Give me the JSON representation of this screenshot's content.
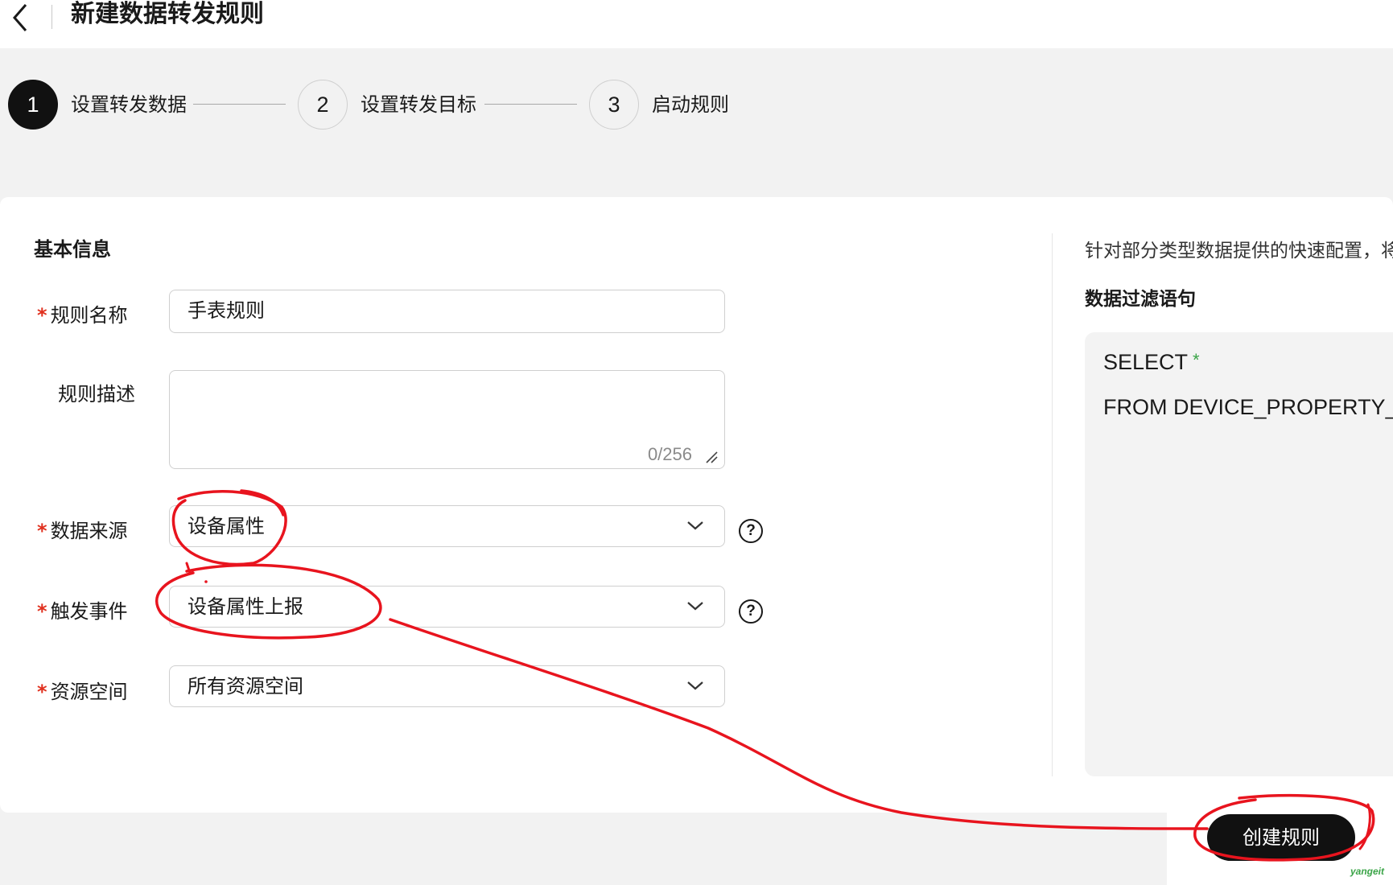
{
  "header": {
    "title": "新建数据转发规则"
  },
  "steps": [
    {
      "number": "1",
      "label": "设置转发数据",
      "active": true
    },
    {
      "number": "2",
      "label": "设置转发目标",
      "active": false
    },
    {
      "number": "3",
      "label": "启动规则",
      "active": false
    }
  ],
  "form": {
    "section_title": "基本信息",
    "rule_name": {
      "label": "规则名称",
      "value": "手表规则"
    },
    "rule_desc": {
      "label": "规则描述",
      "value": "",
      "counter": "0/256"
    },
    "data_source": {
      "label": "数据来源",
      "value": "设备属性"
    },
    "trigger_event": {
      "label": "触发事件",
      "value": "设备属性上报"
    },
    "resource_space": {
      "label": "资源空间",
      "value": "所有资源空间"
    },
    "required_mark": "*",
    "help_mark": "?"
  },
  "side": {
    "tip": "针对部分类型数据提供的快速配置，将",
    "filter_title": "数据过滤语句",
    "sql_line1": "SELECT",
    "sql_star": "*",
    "sql_line2": "FROM DEVICE_PROPERTY_"
  },
  "footer": {
    "create_label": "创建规则"
  },
  "watermark": "yangeit",
  "colors": {
    "required": "#e0301e",
    "annotation": "#e8141e",
    "primary": "#111111",
    "watermark": "#3aa447"
  }
}
